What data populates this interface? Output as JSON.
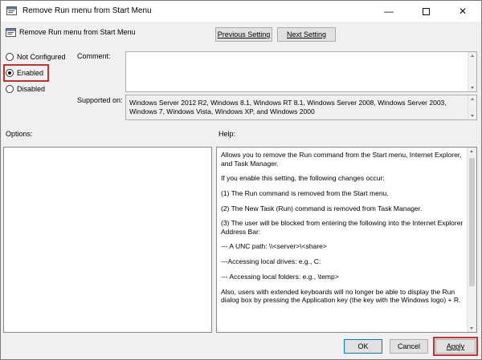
{
  "window": {
    "title": "Remove Run menu from Start Menu"
  },
  "header": {
    "title": "Remove Run menu from Start Menu"
  },
  "nav": {
    "previous_label": "Previous Setting",
    "next_label": "Next Setting"
  },
  "state": {
    "options": [
      {
        "label": "Not Configured",
        "selected": false
      },
      {
        "label": "Enabled",
        "selected": true
      },
      {
        "label": "Disabled",
        "selected": false
      }
    ]
  },
  "comment": {
    "label": "Comment:",
    "value": ""
  },
  "supported": {
    "label": "Supported on:",
    "value": "Windows Server 2012 R2, Windows 8.1, Windows RT 8.1, Windows Server 2008, Windows Server 2003, Windows 7, Windows Vista, Windows XP, and Windows 2000"
  },
  "options_section": {
    "label": "Options:"
  },
  "help": {
    "label": "Help:",
    "paragraphs": [
      "Allows you to remove the Run command from the Start menu, Internet Explorer, and Task Manager.",
      "If you enable this setting, the following changes occur:",
      "(1) The Run command is removed from the Start menu.",
      "(2) The New Task (Run) command is removed from Task Manager.",
      "(3) The user will be blocked from entering the following into the Internet Explorer Address Bar:",
      "--- A UNC path: \\\\<server>\\<share>",
      "---Accessing local drives:  e.g., C:",
      "--- Accessing local folders: e.g., \\temp>",
      "Also, users with extended keyboards will no longer be able to display the Run dialog box by pressing the Application key (the key with the Windows logo) + R."
    ]
  },
  "footer": {
    "ok_label": "OK",
    "cancel_label": "Cancel",
    "apply_label": "Apply"
  },
  "colors": {
    "highlight": "#c0312f",
    "accent": "#0078d7"
  }
}
